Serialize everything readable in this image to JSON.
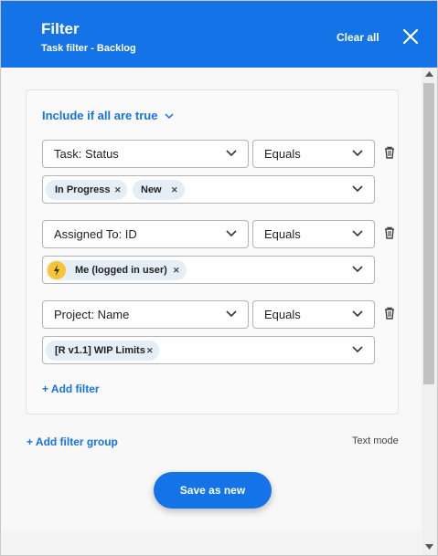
{
  "header": {
    "title": "Filter",
    "subtitle": "Task filter - Backlog",
    "clear_all_label": "Clear all"
  },
  "group": {
    "mode_label": "Include if all are true",
    "filters": [
      {
        "field": "Task: Status",
        "operator": "Equals",
        "values": [
          "In Progress",
          "New"
        ]
      },
      {
        "field": "Assigned To: ID",
        "operator": "Equals",
        "values": [
          "Me (logged in user)"
        ]
      },
      {
        "field": "Project: Name",
        "operator": "Equals",
        "values": [
          "[R v1.1] WIP Limits"
        ]
      }
    ],
    "add_filter_label": "+ Add filter"
  },
  "add_filter_group_label": "+ Add filter group",
  "text_mode_label": "Text mode",
  "save_button_label": "Save as new",
  "colors": {
    "accent": "#1473e6",
    "chip_bg": "#e5edf7",
    "bolt": "#f7c531"
  },
  "icons": {
    "close": "close-icon",
    "chevron": "chevron-down-icon",
    "trash": "trash-icon",
    "remove": "remove-chip-icon",
    "bolt": "lightning-icon"
  }
}
